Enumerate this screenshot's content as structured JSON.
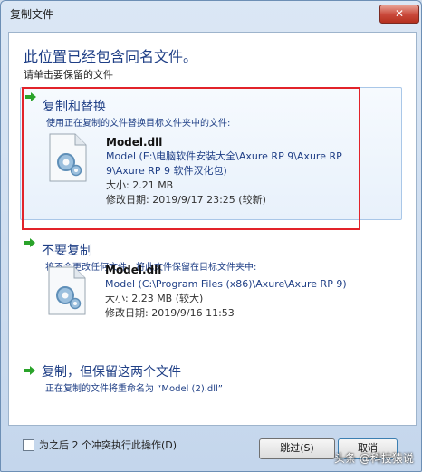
{
  "window": {
    "title": "复制文件",
    "close_label": "✕"
  },
  "heading": "此位置已经包含同名文件。",
  "instruction": "请单击要保留的文件",
  "options": [
    {
      "title": "复制和替换",
      "description": "使用正在复制的文件替换目标文件夹中的文件:",
      "file": {
        "name": "Model.dll",
        "path_line1": "Model (E:\\电脑软件安装大全\\Axure RP 9\\Axure RP",
        "path_line2": "9\\Axure RP 9 软件汉化包)",
        "size": "大小: 2.21 MB",
        "modified": "修改日期: 2019/9/17 23:25 (较新)"
      }
    },
    {
      "title": "不要复制",
      "description": "将不会更改任何文件。将此文件保留在目标文件夹中:",
      "file": {
        "name": "Model.dll",
        "path_line1": "Model (C:\\Program Files (x86)\\Axure\\Axure RP 9)",
        "size": "大小: 2.23 MB (较大)",
        "modified": "修改日期: 2019/9/16 11:53"
      }
    },
    {
      "title": "复制，但保留这两个文件",
      "description": "正在复制的文件将重命名为 “Model (2).dll”"
    }
  ],
  "footer": {
    "checkbox_label": "为之后 2 个冲突执行此操作(D)",
    "skip_label": "跳过(S)",
    "cancel_label": "取消"
  },
  "watermark": "头条 @科技猿说",
  "colors": {
    "accent": "#1f3f86",
    "highlight": "#e2232a",
    "arrow": "#2aa32a"
  }
}
